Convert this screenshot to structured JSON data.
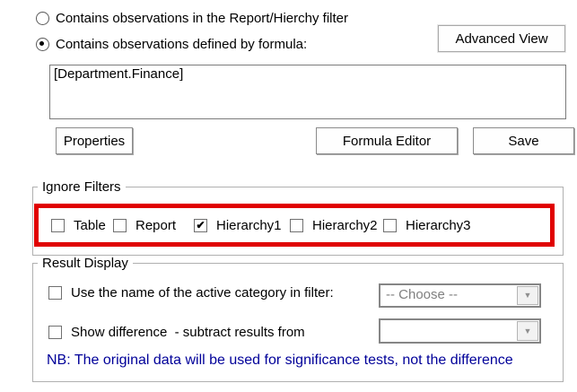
{
  "colors": {
    "highlight_rectangle": "#e00000",
    "note_text": "#000099",
    "disabled_text": "#808080"
  },
  "options": [
    {
      "label": "Contains observations in the Report/Hierchy filter",
      "selected": false
    },
    {
      "label": "Contains observations defined by formula:",
      "selected": true
    }
  ],
  "advanced_view": {
    "label": "Advanced View"
  },
  "formula": {
    "value": "[Department.Finance]"
  },
  "buttons": {
    "properties": "Properties",
    "formula_editor": "Formula Editor",
    "save": "Save"
  },
  "ignore_filters": {
    "title": "Ignore Filters",
    "checkboxes": [
      {
        "label": "Table",
        "checked": false,
        "check_glyph": ""
      },
      {
        "label": "Report",
        "checked": false,
        "check_glyph": ""
      },
      {
        "label": "Hierarchy1",
        "checked": true,
        "check_glyph": "✔"
      },
      {
        "label": "Hierarchy2",
        "checked": false,
        "check_glyph": ""
      },
      {
        "label": "Hierarchy3",
        "checked": false,
        "check_glyph": ""
      }
    ]
  },
  "result_display": {
    "title": "Result Display",
    "category_checkbox": {
      "label": "Use the name of the active category in filter:",
      "checked": false,
      "check_glyph": ""
    },
    "category_dropdown": {
      "value": "-- Choose --",
      "disabled": true
    },
    "difference_checkbox": {
      "label": "Show difference  - subtract results from",
      "checked": false,
      "check_glyph": ""
    },
    "difference_dropdown": {
      "value": "",
      "disabled": true
    },
    "note": "NB: The original data will be used for significance tests, not the difference"
  }
}
